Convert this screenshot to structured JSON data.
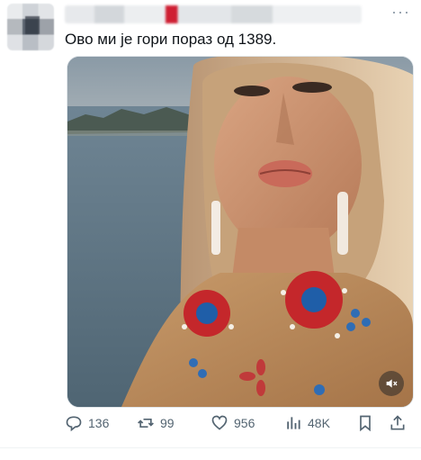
{
  "tweet": {
    "text": "Ово ми је гори пораз од 1389."
  },
  "actions": {
    "replies": "136",
    "reposts": "99",
    "likes": "956",
    "views": "48K"
  },
  "icons": {
    "more": "more-horizontal-icon",
    "reply": "reply-icon",
    "repost": "repost-icon",
    "like": "heart-icon",
    "views": "views-icon",
    "bookmark": "bookmark-icon",
    "share": "share-icon",
    "mute": "mute-icon"
  },
  "colors": {
    "icon_gray": "#536471",
    "text": "#0f1419"
  }
}
